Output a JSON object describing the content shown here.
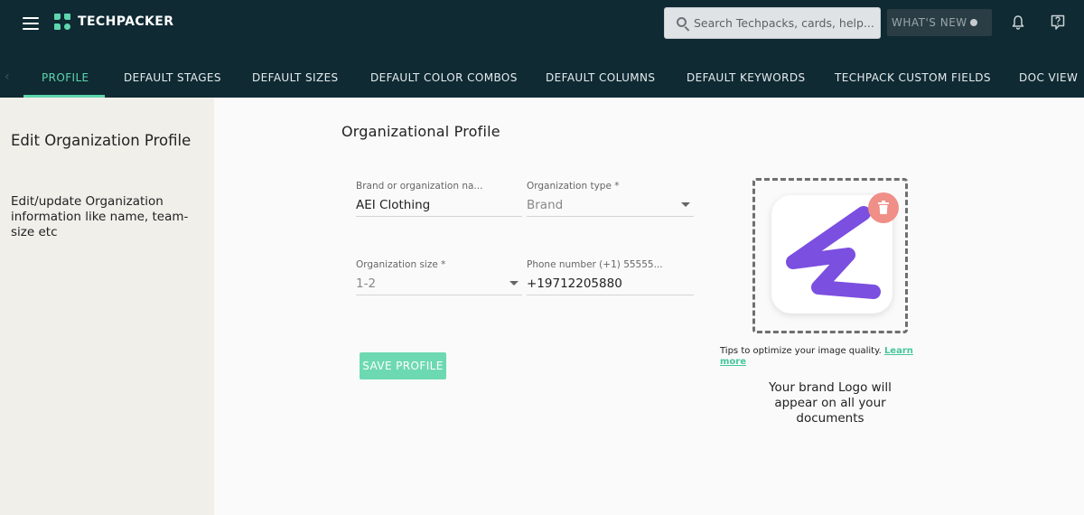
{
  "header": {
    "brand": "TECHPACKER",
    "search_placeholder": "Search Techpacks, cards, help...",
    "whats_new": "WHAT'S NEW"
  },
  "tabs": [
    {
      "label": "PROFILE",
      "active": true
    },
    {
      "label": "DEFAULT STAGES"
    },
    {
      "label": "DEFAULT SIZES"
    },
    {
      "label": "DEFAULT COLOR COMBOS"
    },
    {
      "label": "DEFAULT COLUMNS"
    },
    {
      "label": "DEFAULT KEYWORDS"
    },
    {
      "label": "TECHPACK CUSTOM FIELDS"
    },
    {
      "label": "DOC VIEW"
    }
  ],
  "sidebar": {
    "title": "Edit Organization Profile",
    "description": "Edit/update Organization information like name, team-size etc"
  },
  "main": {
    "title": "Organizational Profile",
    "fields": {
      "org_name": {
        "label": "Brand or organization na...",
        "value": "AEI Clothing"
      },
      "org_type": {
        "label": "Organization type *",
        "value": "Brand"
      },
      "org_size": {
        "label": "Organization size *",
        "value": "1-2"
      },
      "phone": {
        "label": "Phone number (+1) 55555...",
        "value": "+19712205880"
      }
    },
    "save_label": "SAVE PROFILE"
  },
  "logo": {
    "tips_text": "Tips to optimize your image quality.",
    "learn_more": "Learn more",
    "note": "Your brand Logo will appear on all your documents"
  },
  "colors": {
    "topbar": "#0f2a33",
    "accent": "#5ed6ad",
    "save_button": "#6dd9b2",
    "delete_button": "#ef8f87",
    "logo_stroke": "#7b4fe0"
  }
}
